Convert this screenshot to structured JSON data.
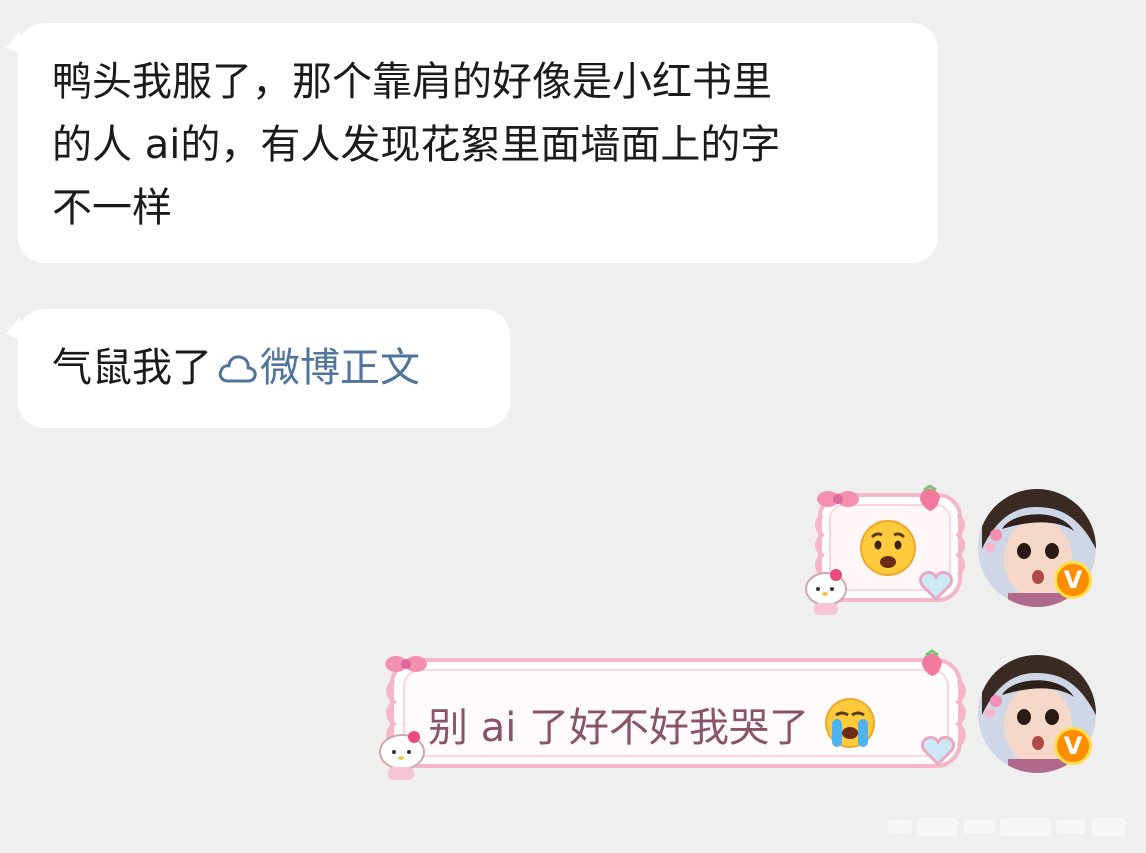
{
  "messages": [
    {
      "sender": "other",
      "text": "鸭头我服了，那个靠肩的好像是小红书里的人ai的，有人发现花絮里面墙面上的字不一样",
      "lines": [
        "鸭头我服了，那个靠肩的好像是小红书里",
        "的人 ai的，有人发现花絮里面墙面上的字",
        "不一样"
      ]
    },
    {
      "sender": "other",
      "text": "气鼠我了",
      "link_text": "微博正文",
      "link_icon": "weibo-cloud-icon"
    },
    {
      "sender": "self",
      "emoji": "anxious-face-emoji",
      "bubble_style": "pink-hello-kitty-frame"
    },
    {
      "sender": "self",
      "text": "别 ai 了好不好我哭了",
      "emoji": "loudly-crying-face-emoji",
      "bubble_style": "pink-hello-kitty-frame"
    }
  ],
  "self_avatar": {
    "badge_text": "V",
    "badge_color": "#ff8d00"
  },
  "colors": {
    "background": "#efeff0",
    "incoming_bubble": "#ffffff",
    "link": "#50749b",
    "outgoing_text": "#8a5468",
    "frame_pink": "#f5b6c8"
  }
}
